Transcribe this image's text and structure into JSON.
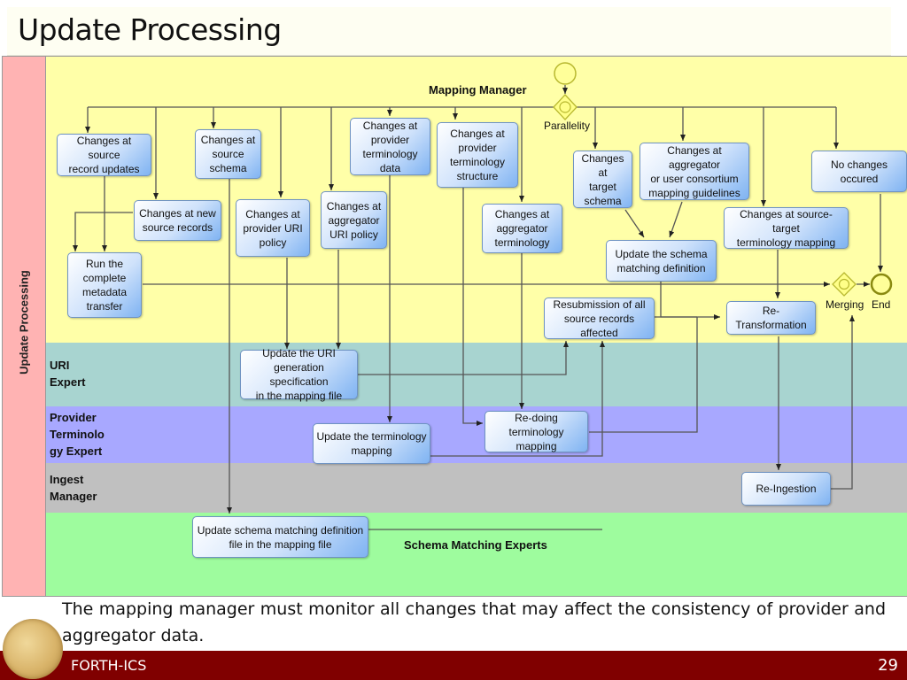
{
  "slide": {
    "title": "Update Processing",
    "footer_text": "The mapping manager must monitor all changes that may affect the consistency of provider and aggregator data.",
    "footer_org": "FORTH-ICS",
    "page_number": "29",
    "footer_bar_color": "#800000"
  },
  "diagram": {
    "pool_label": "Update Processing",
    "lanes": [
      {
        "id": "mm",
        "name": "Mapping Manager",
        "color": "#ffffa8"
      },
      {
        "id": "uri",
        "name": "URI\nExpert",
        "color": "#a8d4d0"
      },
      {
        "id": "pte",
        "name": "Provider\nTerminolo\ngy Expert",
        "color": "#a8a8ff"
      },
      {
        "id": "ing",
        "name": "Ingest\nManager",
        "color": "#c0c0c0"
      },
      {
        "id": "sme",
        "name": "Schema Matching Experts",
        "color": "#9efc9e"
      }
    ],
    "events": {
      "start": "",
      "parallel_gateway": "Parallelity",
      "merge_gateway": "Merging",
      "end": "End"
    },
    "tasks": [
      {
        "id": "t1",
        "label": "Changes at source\nrecord updates"
      },
      {
        "id": "t2",
        "label": "Changes at\nsource\nschema"
      },
      {
        "id": "t3",
        "label": "Changes at new\nsource records"
      },
      {
        "id": "t4",
        "label": "Changes at\nprovider URI\npolicy"
      },
      {
        "id": "t5",
        "label": "Changes at\naggregator\nURI policy"
      },
      {
        "id": "t6",
        "label": "Changes at\nprovider\nterminology data"
      },
      {
        "id": "t7",
        "label": "Changes at\nprovider\nterminology\nstructure"
      },
      {
        "id": "t8",
        "label": "Changes at\naggregator\nterminology"
      },
      {
        "id": "t9",
        "label": "Changes at\ntarget\nschema"
      },
      {
        "id": "t10",
        "label": "Changes at aggregator\nor user consortium\nmapping guidelines"
      },
      {
        "id": "t11",
        "label": "No changes occured"
      },
      {
        "id": "t12",
        "label": "Changes at source-target\nterminology mapping"
      },
      {
        "id": "t13",
        "label": "Update the schema\nmatching definition"
      },
      {
        "id": "t14",
        "label": "Run the\ncomplete\nmetadata\ntransfer"
      },
      {
        "id": "t15",
        "label": "Resubmission of all\nsource records affected"
      },
      {
        "id": "t16",
        "label": "Re-Transformation"
      },
      {
        "id": "t17",
        "label": "Update the URI\ngeneration specification\nin the mapping file"
      },
      {
        "id": "t18",
        "label": "Update the terminology\nmapping"
      },
      {
        "id": "t19",
        "label": "Re-doing terminology\nmapping"
      },
      {
        "id": "t20",
        "label": "Re-Ingestion"
      },
      {
        "id": "t21",
        "label": "Update schema matching definition\nfile in the mapping file"
      }
    ]
  }
}
